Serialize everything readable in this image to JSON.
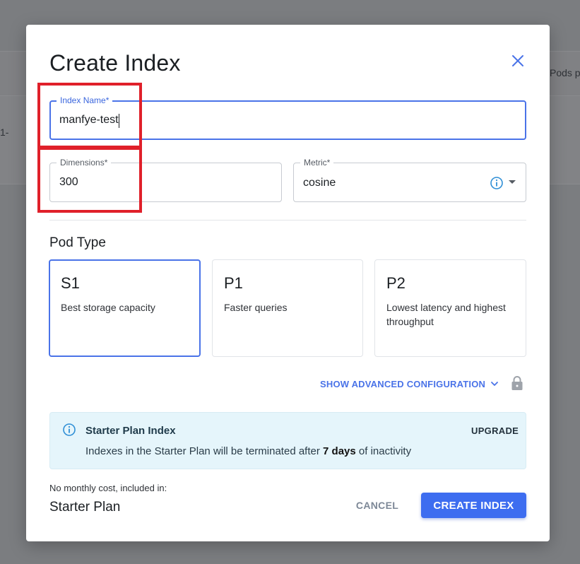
{
  "background": {
    "header_fragment": "Pods p",
    "row_fragment": "1-"
  },
  "dialog": {
    "title": "Create Index",
    "close_icon": "close-icon"
  },
  "fields": {
    "index_name": {
      "label": "Index Name",
      "required_mark": "*",
      "value": "manfye-test"
    },
    "dimensions": {
      "label": "Dimensions",
      "required_mark": "*",
      "value": "300"
    },
    "metric": {
      "label": "Metric",
      "required_mark": "*",
      "value": "cosine",
      "info_icon": "info-icon",
      "dropdown_icon": "dropdown-arrow-icon"
    }
  },
  "pod_type": {
    "title": "Pod Type",
    "selected": "S1",
    "options": [
      {
        "name": "S1",
        "description": "Best storage capacity"
      },
      {
        "name": "P1",
        "description": "Faster queries"
      },
      {
        "name": "P2",
        "description": "Lowest latency and highest throughput"
      }
    ]
  },
  "advanced": {
    "label": "SHOW ADVANCED CONFIGURATION",
    "chevron_icon": "chevron-down-icon",
    "lock_icon": "lock-icon"
  },
  "alert": {
    "title": "Starter Plan Index",
    "text_before": "Indexes in the Starter Plan will be terminated after ",
    "text_bold": "7 days",
    "text_after": " of inactivity",
    "action": "UPGRADE"
  },
  "footer": {
    "cost_note": "No monthly cost, included in:",
    "plan": "Starter Plan",
    "cancel_label": "CANCEL",
    "create_label": "CREATE INDEX"
  },
  "colors": {
    "accent": "#3d6df0",
    "focus_border": "#4a73e8",
    "alert_background": "#e5f5fb",
    "annotation_red": "#e0202a"
  }
}
